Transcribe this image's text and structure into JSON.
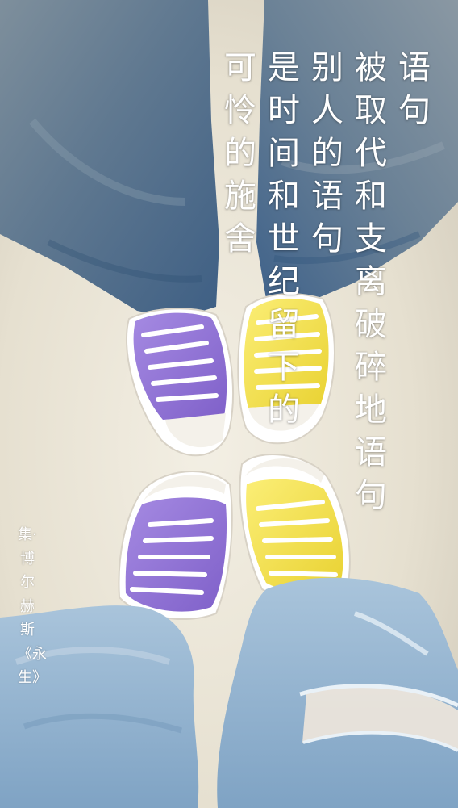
{
  "poem": {
    "lines": [
      "语句",
      "被取代和支离破碎地语句",
      "别人的语句",
      "是时间和世纪留下的",
      "可怜的施舍"
    ]
  },
  "attribution": {
    "text": "集·博尔赫斯《永生》"
  },
  "colors": {
    "floor": "#e9e4d6",
    "denim_top": "#4f6d8a",
    "denim_bottom": "#9dbcd6",
    "purple_shoe": "#9478d8",
    "yellow_shoe": "#f3e04e",
    "text": "#ffffff"
  }
}
